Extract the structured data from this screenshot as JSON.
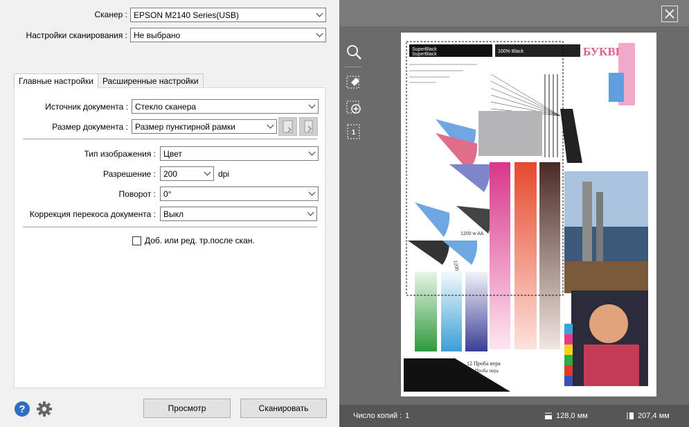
{
  "scanner": {
    "label": "Сканер :",
    "value": "EPSON M2140 Series(USB)"
  },
  "scan_settings": {
    "label": "Настройки сканирования :",
    "value": "Не выбрано"
  },
  "tabs": [
    {
      "label": "Главные настройки",
      "active": true
    },
    {
      "label": "Расширенные настройки",
      "active": false
    }
  ],
  "main": {
    "document_source": {
      "label": "Источник документа :",
      "value": "Стекло сканера"
    },
    "document_size": {
      "label": "Размер документа :",
      "value": "Размер пунктирной рамки"
    },
    "image_type": {
      "label": "Тип изображения :",
      "value": "Цвет"
    },
    "resolution": {
      "label": "Разрешение :",
      "value": "200",
      "unit": "dpi"
    },
    "rotation": {
      "label": "Поворот :",
      "value": "0°"
    },
    "skew_correction": {
      "label": "Коррекция перекоса документа :",
      "value": "Выкл"
    },
    "add_edit_pages": {
      "label": "Доб. или ред. тр.после скан.",
      "checked": false
    }
  },
  "buttons": {
    "preview": "Просмотр",
    "scan": "Сканировать"
  },
  "footer_icons": [
    "help-icon",
    "gear-icon"
  ],
  "preview_tools": [
    "zoom-icon",
    "eraser-icon",
    "add-page-icon",
    "page-count-icon"
  ],
  "preview_toolbar": {
    "page_count": "1"
  },
  "preview_image": {
    "texts": {
      "superblack": "SuperBlack",
      "black100": "100% Black",
      "bukvy": "БУКВЫ",
      "lpi_1200": "1200 lpi aa",
      "w_1200": "1200 w AA",
      "proba_pera_12": "12 Проба пера",
      "proba_pera_10": "10 Проба пера"
    }
  },
  "status": {
    "copies_label": "Число копий :",
    "copies": "1",
    "width": "128,0 мм",
    "height": "207,4 мм"
  },
  "colors": {
    "accent": "#2e6fc4",
    "panel_bg": "#f0f0f0",
    "preview_bg": "#6b6b6b"
  }
}
